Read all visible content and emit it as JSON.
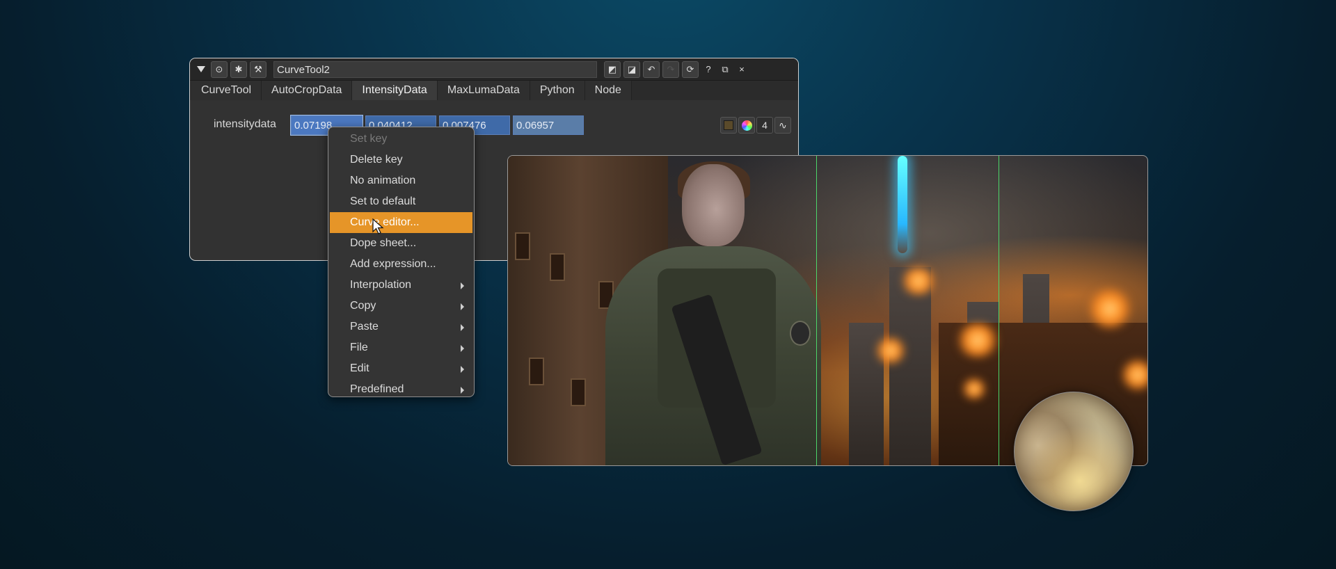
{
  "panel": {
    "node_name": "CurveTool2",
    "title_icons": [
      "collapse-icon",
      "node-icon",
      "bug-icon",
      "wrench-icon"
    ],
    "tabs": [
      {
        "label": "CurveTool",
        "active": false
      },
      {
        "label": "AutoCropData",
        "active": false
      },
      {
        "label": "IntensityData",
        "active": true
      },
      {
        "label": "MaxLumaData",
        "active": false
      },
      {
        "label": "Python",
        "active": false
      },
      {
        "label": "Node",
        "active": false
      }
    ],
    "knob": {
      "label": "intensitydata",
      "values": [
        "0.07198",
        "0.040412",
        "0.007476",
        "0.06957"
      ],
      "channel_count": "4"
    },
    "help_label": "?",
    "close_label": "×"
  },
  "menu": {
    "items": [
      {
        "label": "Set key",
        "disabled": true,
        "submenu": false
      },
      {
        "label": "Delete key",
        "disabled": false,
        "submenu": false
      },
      {
        "label": "No animation",
        "disabled": false,
        "submenu": false
      },
      {
        "label": "Set to default",
        "disabled": false,
        "submenu": false
      },
      {
        "label": "Curve editor...",
        "disabled": false,
        "submenu": false,
        "highlighted": true
      },
      {
        "label": "Dope sheet...",
        "disabled": false,
        "submenu": false
      },
      {
        "label": "Add expression...",
        "disabled": false,
        "submenu": false
      },
      {
        "label": "Interpolation",
        "disabled": false,
        "submenu": true
      },
      {
        "label": "Copy",
        "disabled": false,
        "submenu": true
      },
      {
        "label": "Paste",
        "disabled": false,
        "submenu": true
      },
      {
        "label": "File",
        "disabled": false,
        "submenu": true
      },
      {
        "label": "Edit",
        "disabled": false,
        "submenu": true
      },
      {
        "label": "Predefined",
        "disabled": false,
        "submenu": true
      }
    ]
  },
  "colors": {
    "accent_highlight": "#e69528",
    "field_blue": "#3f6aa8",
    "guide_green": "#4cd66a"
  }
}
